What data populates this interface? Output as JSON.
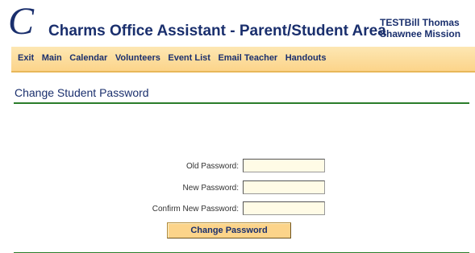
{
  "header": {
    "logo_letter": "C",
    "app_title": "Charms Office Assistant - Parent/Student Area",
    "user_name": "TESTBill Thomas",
    "organization": "Shawnee Mission"
  },
  "nav": {
    "items": [
      {
        "label": "Exit"
      },
      {
        "label": "Main"
      },
      {
        "label": "Calendar"
      },
      {
        "label": "Volunteers"
      },
      {
        "label": "Event List"
      },
      {
        "label": "Email Teacher"
      },
      {
        "label": "Handouts"
      }
    ]
  },
  "page": {
    "title": "Change Student Password"
  },
  "form": {
    "old_password_label": "Old Password:",
    "old_password_value": "",
    "new_password_label": "New Password:",
    "new_password_value": "",
    "confirm_password_label": "Confirm New Password:",
    "confirm_password_value": "",
    "submit_label": "Change Password"
  },
  "colors": {
    "title_blue": "#1a2f6d",
    "nav_bg": "#fcd48a",
    "rule_green": "#2b7d2b",
    "input_bg": "#fffbe6"
  }
}
